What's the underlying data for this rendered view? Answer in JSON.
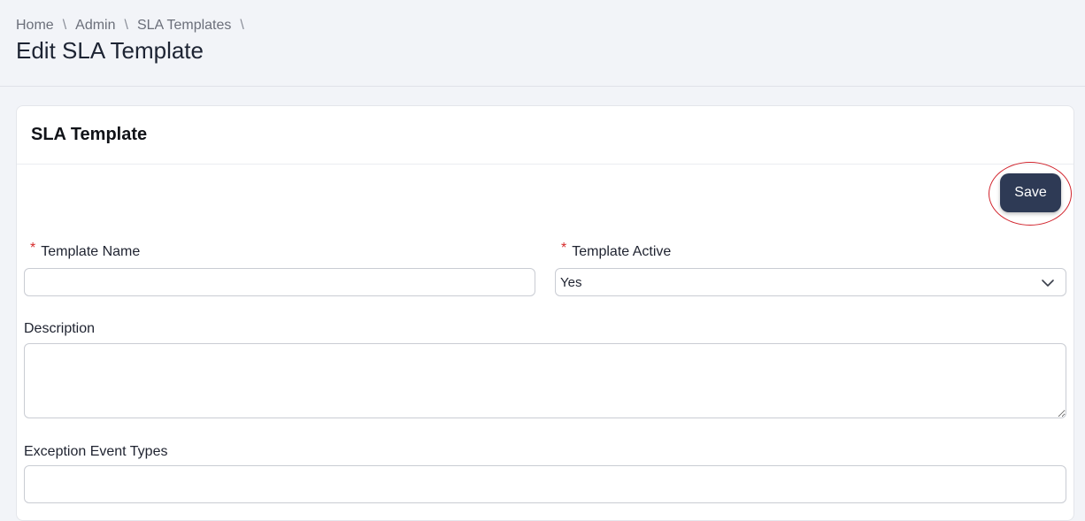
{
  "breadcrumb": {
    "items": [
      {
        "label": "Home"
      },
      {
        "label": "Admin"
      },
      {
        "label": "SLA Templates"
      }
    ],
    "separator": "\\"
  },
  "page": {
    "title": "Edit SLA Template"
  },
  "card": {
    "title": "SLA Template",
    "save_label": "Save"
  },
  "form": {
    "template_name": {
      "label": "Template Name",
      "required_marker": "*",
      "value": ""
    },
    "template_active": {
      "label": "Template Active",
      "required_marker": "*",
      "selected": "Yes"
    },
    "description": {
      "label": "Description",
      "value": ""
    },
    "exception_event_types": {
      "label": "Exception Event Types",
      "value": ""
    }
  },
  "colors": {
    "save_button": "#2e3a55",
    "required_star": "#d62b2b",
    "highlight_ring": "#d1222b",
    "page_background": "#f2f4f8"
  },
  "icons": {
    "select_chevron": "chevron-down-icon",
    "textarea_grip": "resize-grip-icon"
  }
}
